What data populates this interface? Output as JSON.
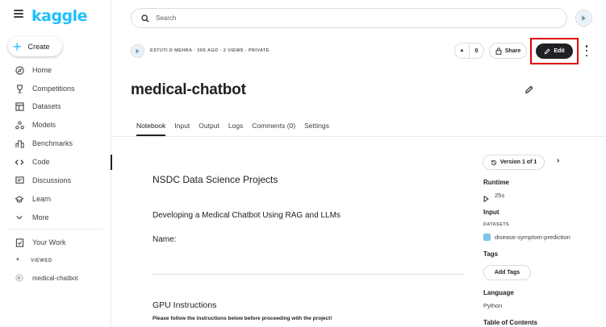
{
  "brand": {
    "logo": "kaggle"
  },
  "sidebar": {
    "create_label": "Create",
    "items": [
      {
        "label": "Home",
        "icon": "compass-icon"
      },
      {
        "label": "Competitions",
        "icon": "trophy-icon"
      },
      {
        "label": "Datasets",
        "icon": "table-icon"
      },
      {
        "label": "Models",
        "icon": "models-icon"
      },
      {
        "label": "Benchmarks",
        "icon": "benchmarks-icon"
      },
      {
        "label": "Code",
        "icon": "code-icon"
      },
      {
        "label": "Discussions",
        "icon": "comment-icon"
      },
      {
        "label": "Learn",
        "icon": "school-icon"
      },
      {
        "label": "More",
        "icon": "chevron-down-icon"
      }
    ],
    "your_work_label": "Your Work",
    "viewed_label": "VIEWED",
    "viewed_items": [
      {
        "label": "medical-chatbot"
      }
    ]
  },
  "search": {
    "placeholder": "Search"
  },
  "notebook": {
    "meta": "ESTUTI D MEHRA · 30S AGO · 2 VIEWS · PRIVATE",
    "vote_count": "0",
    "share_label": "Share",
    "edit_label": "Edit",
    "title": "medical-chatbot"
  },
  "tabs": [
    {
      "label": "Notebook"
    },
    {
      "label": "Input"
    },
    {
      "label": "Output"
    },
    {
      "label": "Logs"
    },
    {
      "label": "Comments (0)"
    },
    {
      "label": "Settings"
    }
  ],
  "content": {
    "heading": "NSDC Data Science Projects",
    "subheading": "Developing a Medical Chatbot Using RAG and LLMs",
    "name_label": "Name:",
    "gpu_heading": "GPU Instructions",
    "gpu_text": "Please follow the instructions below before proceeding with the project!"
  },
  "right_panel": {
    "version_label": "Version 1 of 1",
    "runtime_label": "Runtime",
    "runtime_value": "25s",
    "input_label": "Input",
    "datasets_caption": "DATASETS",
    "dataset_name": "disease-symptom-prediction",
    "tags_label": "Tags",
    "add_tags_label": "Add Tags",
    "language_label": "Language",
    "language_value": "Python",
    "toc_label": "Table of Contents"
  },
  "colors": {
    "accent": "#20beff",
    "highlight": "#e00000",
    "dark": "#202124"
  }
}
